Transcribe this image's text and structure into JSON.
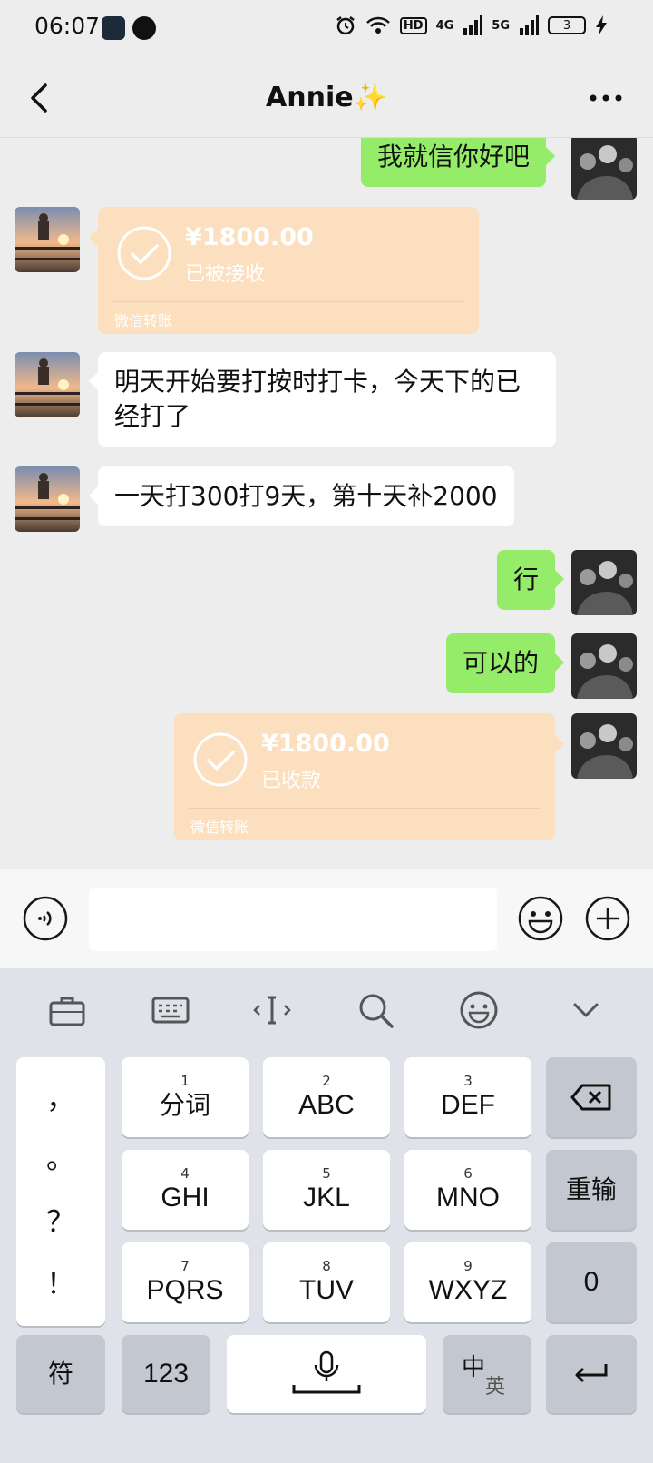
{
  "status_bar": {
    "time": "06:07",
    "network_hd": "HD",
    "network_4g": "4G",
    "network_5g": "5G",
    "battery": "3"
  },
  "nav": {
    "title": "Annie✨"
  },
  "messages": [
    {
      "side": "right",
      "type": "text",
      "text": "我就信你好吧"
    },
    {
      "side": "left",
      "type": "transfer",
      "amount": "¥1800.00",
      "status": "已被接收",
      "footer": "微信转账"
    },
    {
      "side": "left",
      "type": "text",
      "text": "明天开始要打按时打卡，今天下的已经打了"
    },
    {
      "side": "left",
      "type": "text",
      "text": "一天打300打9天，第十天补2000"
    },
    {
      "side": "right",
      "type": "text",
      "text": "行"
    },
    {
      "side": "right",
      "type": "text",
      "text": "可以的"
    },
    {
      "side": "right",
      "type": "transfer",
      "amount": "¥1800.00",
      "status": "已收款",
      "footer": "微信转账"
    }
  ],
  "input": {
    "value": "",
    "placeholder": ""
  },
  "keyboard": {
    "punctuation": [
      "，",
      "。",
      "？",
      "！"
    ],
    "keys": [
      {
        "num": "1",
        "label": "分词"
      },
      {
        "num": "2",
        "label": "ABC"
      },
      {
        "num": "3",
        "label": "DEF"
      },
      {
        "num": "4",
        "label": "GHI"
      },
      {
        "num": "5",
        "label": "JKL"
      },
      {
        "num": "6",
        "label": "MNO"
      },
      {
        "num": "7",
        "label": "PQRS"
      },
      {
        "num": "8",
        "label": "TUV"
      },
      {
        "num": "9",
        "label": "WXYZ"
      }
    ],
    "reinput": "重输",
    "zero": "0",
    "symbol": "符",
    "num_mode": "123",
    "lang_main": "中",
    "lang_sub": "英"
  }
}
